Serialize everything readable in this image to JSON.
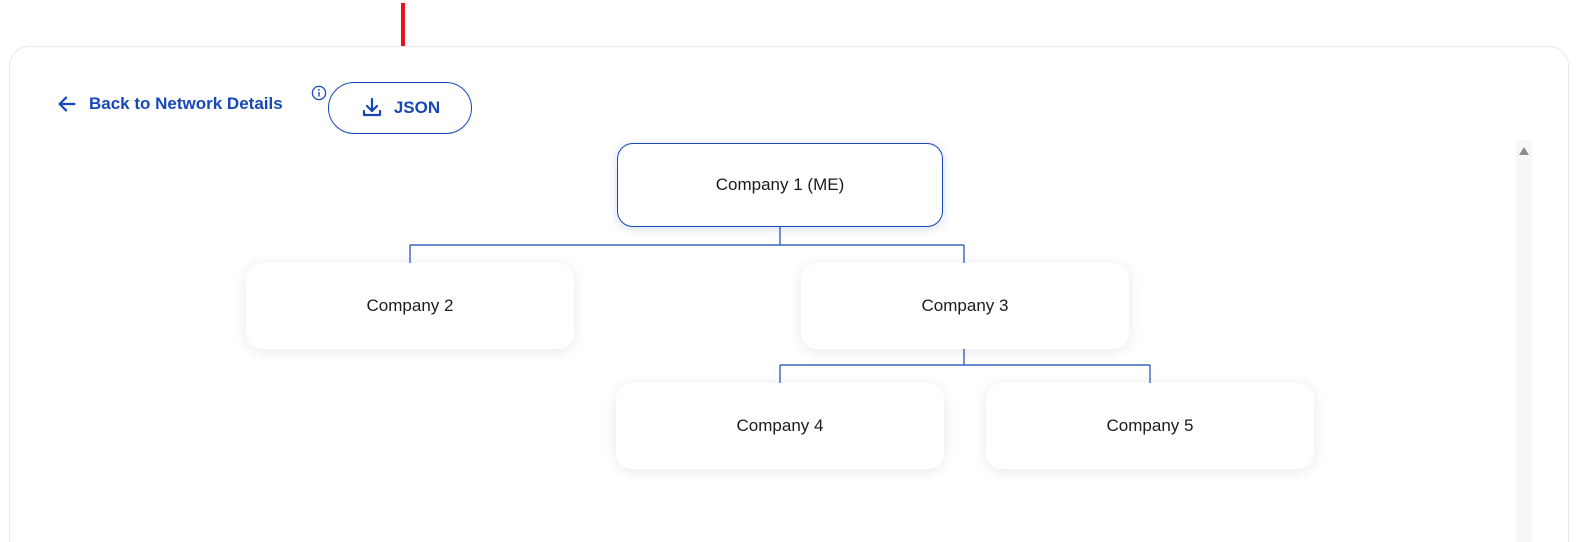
{
  "toolbar": {
    "back_label": "Back to Network Details",
    "json_label": "JSON"
  },
  "icons": {
    "back": "arrow-left-icon",
    "info": "info-icon",
    "download": "download-icon",
    "scroll_up": "caret-up-icon"
  },
  "colors": {
    "accent": "#1548b8",
    "annotation": "#e8121a",
    "node_text": "#1b1b1b"
  },
  "tree": {
    "root": "Company 1 (ME)",
    "children": [
      "Company 2",
      "Company 3"
    ],
    "grandchildren": [
      "Company 4",
      "Company 5"
    ]
  }
}
